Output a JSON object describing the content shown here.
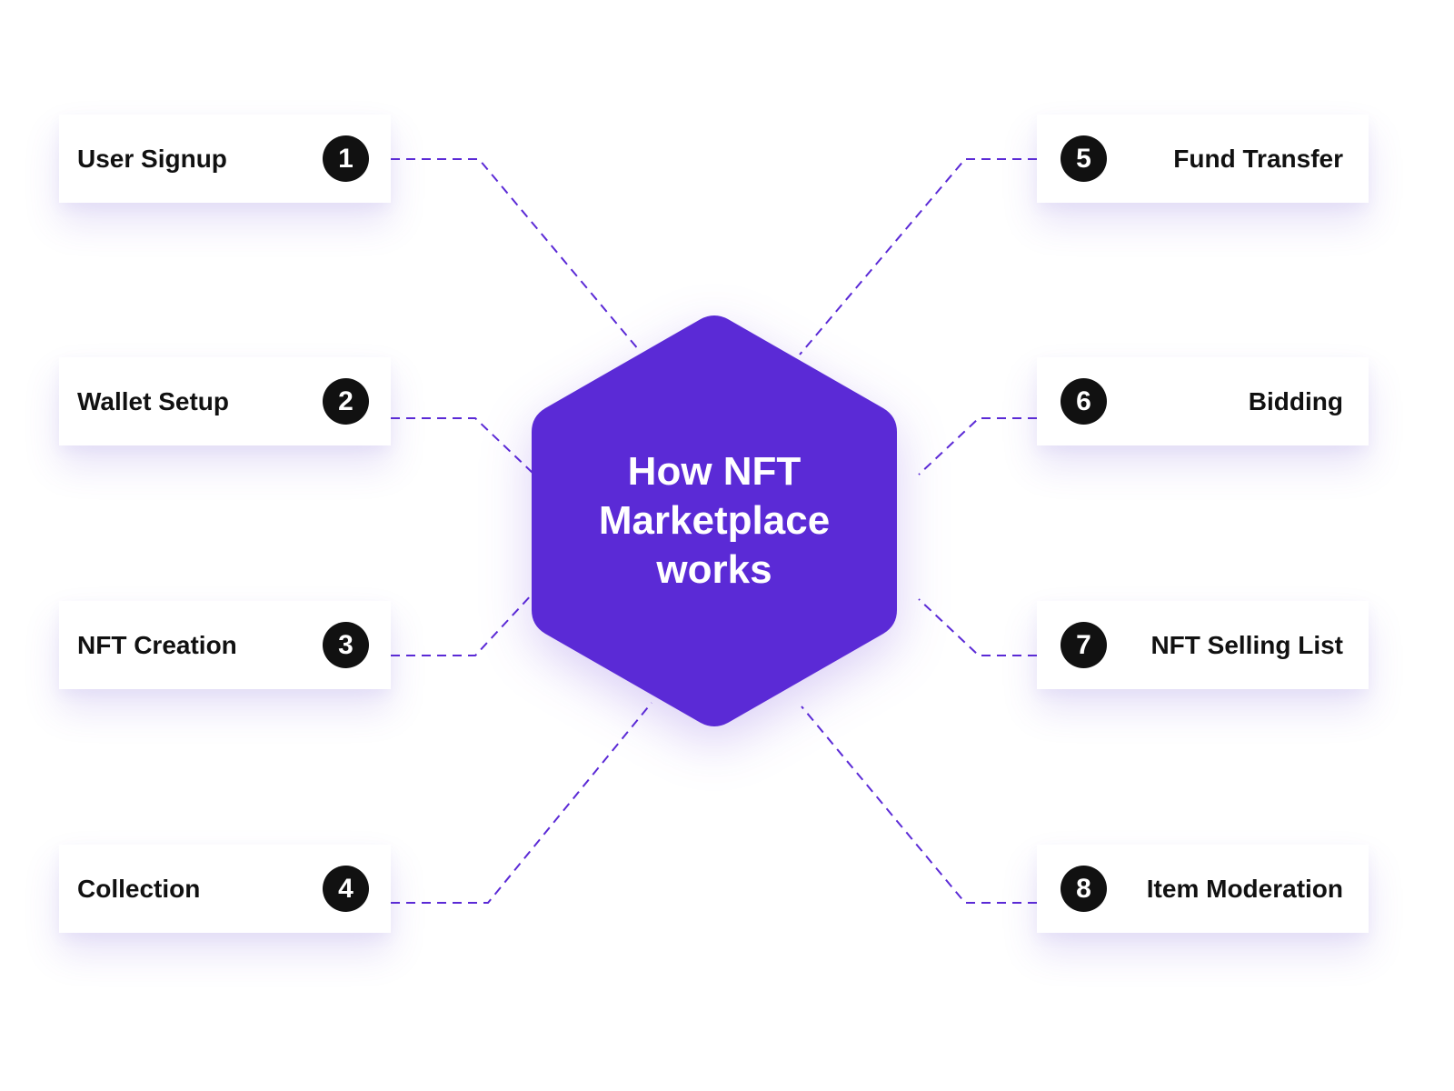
{
  "diagram": {
    "center_title": "How NFT\nMarketplace\nworks",
    "colors": {
      "accent": "#5b2ad6",
      "badge": "#111111",
      "card": "#ffffff",
      "label": "#111111"
    },
    "left_steps": [
      {
        "number": "1",
        "label": "User Signup"
      },
      {
        "number": "2",
        "label": "Wallet Setup"
      },
      {
        "number": "3",
        "label": "NFT Creation"
      },
      {
        "number": "4",
        "label": "Collection"
      }
    ],
    "right_steps": [
      {
        "number": "5",
        "label": "Fund Transfer"
      },
      {
        "number": "6",
        "label": "Bidding"
      },
      {
        "number": "7",
        "label": "NFT Selling List"
      },
      {
        "number": "8",
        "label": "Item Moderation"
      }
    ]
  }
}
